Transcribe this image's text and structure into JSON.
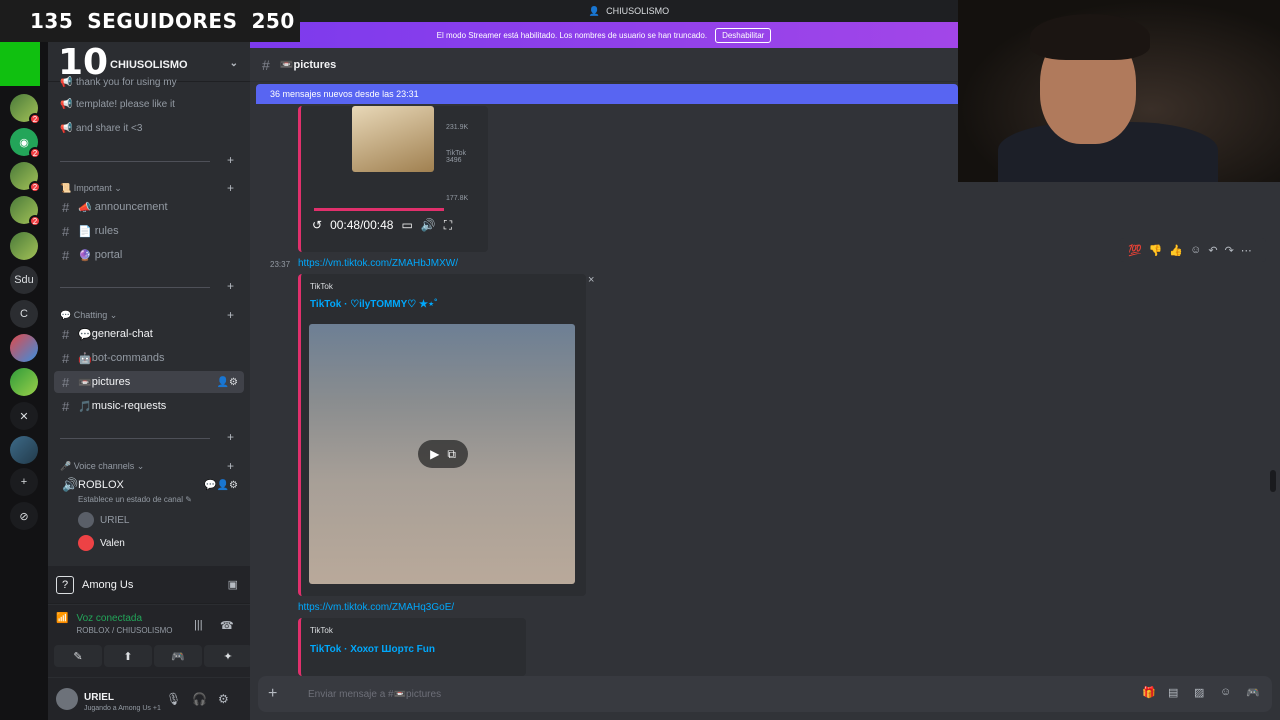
{
  "overlay": {
    "followers_current": "135",
    "followers_label": "SEGUIDORES",
    "followers_goal": "250",
    "counter": "10"
  },
  "topbar": {
    "server_title": "CHIUSOLISMO"
  },
  "streamer_banner": {
    "text": "El modo Streamer está habilitado. Los nombres de usuario se han truncado.",
    "button": "Deshabilitar"
  },
  "guild": {
    "name": "CHIUSOLISMO"
  },
  "rail": {
    "servers": [
      "",
      "",
      "",
      "",
      "",
      "",
      "Sdu",
      "C",
      "",
      "",
      "",
      "",
      "+",
      ""
    ],
    "badge": "2"
  },
  "sidebar": {
    "messages": [
      "thank you for using my",
      "template! please like it",
      "and share it <3"
    ],
    "cat_important": "Important",
    "important_channels": [
      {
        "emoji": "📣",
        "name": "announcement"
      },
      {
        "emoji": "📄",
        "name": "rules"
      },
      {
        "emoji": "🔮",
        "name": "portal"
      }
    ],
    "cat_chatting": "Chatting",
    "chatting_channels": [
      {
        "emoji": "💬",
        "name": "general-chat"
      },
      {
        "emoji": "🤖",
        "name": "bot-commands"
      },
      {
        "emoji": "📼",
        "name": "pictures"
      },
      {
        "emoji": "🎵",
        "name": "music-requests"
      }
    ],
    "cat_voice": "Voice channels",
    "voice_channel": "ROBLOX",
    "voice_status": "Establece un estado de canal",
    "voice_users": [
      "URIEL",
      "Valen"
    ]
  },
  "activity": {
    "name": "Among Us"
  },
  "voice_panel": {
    "status": "Voz conectada",
    "location": "ROBLOX / CHIUSOLISMO"
  },
  "user": {
    "name": "URIEL",
    "activity": "Jugando a Among Us +1"
  },
  "channel": {
    "name": "📼pictures",
    "new_messages": "36 mensajes nuevos desde las 23:31"
  },
  "embed1": {
    "time": "00:48/00:48",
    "likes": "231.9K",
    "comments": "TikTok 3496",
    "shares": "177.8K"
  },
  "message2": {
    "timestamp": "23:37",
    "link": "https://vm.tiktok.com/ZMAHbJMXW/",
    "provider": "TikTok",
    "title": "TikTok · ♡ilyTOMMY♡ ★⋆˚"
  },
  "message3": {
    "link": "https://vm.tiktok.com/ZMAHq3GoE/",
    "provider": "TikTok",
    "title": "TikTok · Хохот Шортс Fun"
  },
  "composer": {
    "placeholder": "Enviar mensaje a #📼pictures"
  }
}
